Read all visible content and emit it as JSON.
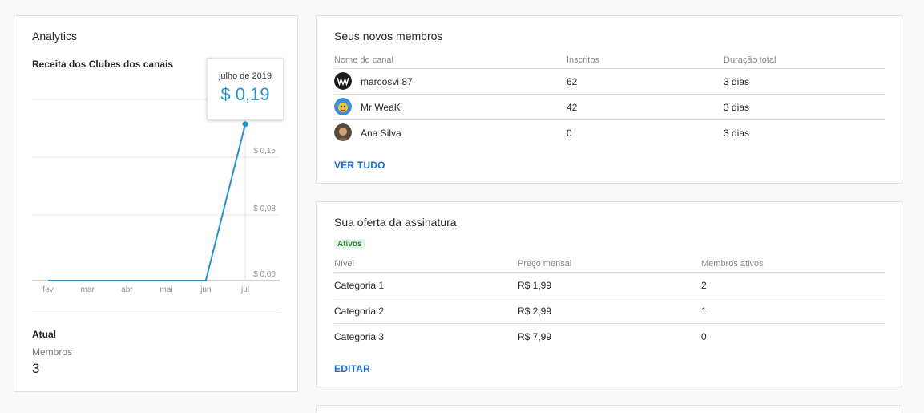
{
  "analytics": {
    "title": "Analytics",
    "chart_title": "Receita dos Clubes dos canais",
    "tooltip": {
      "label": "julho de 2019",
      "value": "$ 0,19"
    },
    "atual_label": "Atual",
    "membros_label": "Membros",
    "membros_value": "3"
  },
  "chart_data": {
    "type": "line",
    "title": "Receita dos Clubes dos canais",
    "categories": [
      "fev",
      "mar",
      "abr",
      "mai",
      "jun",
      "jul"
    ],
    "series": [
      {
        "values": [
          0,
          0,
          0,
          0,
          0,
          0.19
        ]
      }
    ],
    "y_ticks": [
      {
        "value": 0.0,
        "label": "$ 0,00"
      },
      {
        "value": 0.08,
        "label": "$ 0,08"
      },
      {
        "value": 0.15,
        "label": "$ 0,15"
      }
    ],
    "ylim": [
      0,
      0.22
    ],
    "grid": true,
    "color": "#2793c9"
  },
  "members": {
    "title": "Seus novos membros",
    "headers": [
      "Nome do canal",
      "Inscritos",
      "Duração total"
    ],
    "rows": [
      {
        "name": "marcosvi 87",
        "subs": "62",
        "duration": "3 dias",
        "avatar": "wwe-logo-icon"
      },
      {
        "name": "Mr WeaK",
        "subs": "42",
        "duration": "3 dias",
        "avatar": "cartoon-avatar-icon"
      },
      {
        "name": "Ana Silva",
        "subs": "0",
        "duration": "3 dias",
        "avatar": "photo-avatar-icon"
      }
    ],
    "link": "VER TUDO"
  },
  "offer": {
    "title": "Sua oferta da assinatura",
    "badge": "Ativos",
    "headers": [
      "Nível",
      "Preço mensal",
      "Membros ativos"
    ],
    "rows": [
      {
        "level": "Categoria 1",
        "price": "R$ 1,99",
        "active": "2"
      },
      {
        "level": "Categoria 2",
        "price": "R$ 2,99",
        "active": "1"
      },
      {
        "level": "Categoria 3",
        "price": "R$ 7,99",
        "active": "0"
      }
    ],
    "link": "EDITAR"
  }
}
